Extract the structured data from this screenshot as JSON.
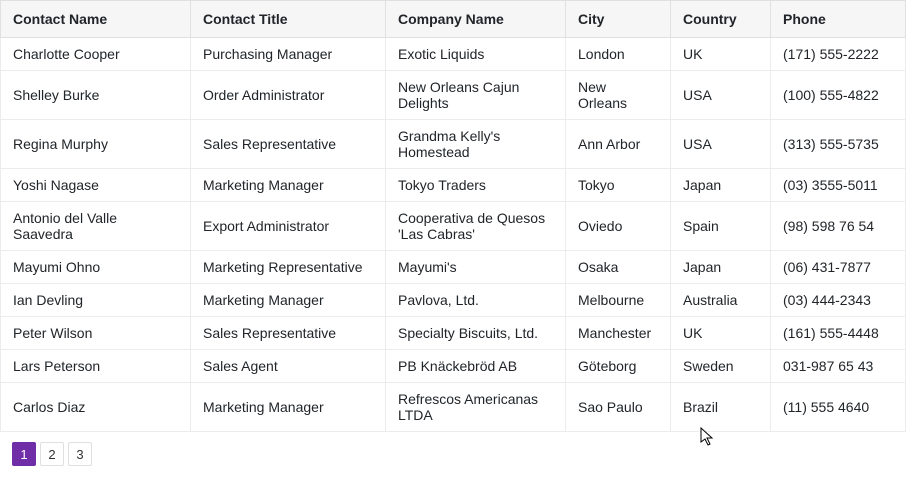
{
  "table": {
    "columns": [
      "Contact Name",
      "Contact Title",
      "Company Name",
      "City",
      "Country",
      "Phone"
    ],
    "rows": [
      {
        "name": "Charlotte Cooper",
        "title": "Purchasing Manager",
        "company": "Exotic Liquids",
        "city": "London",
        "country": "UK",
        "phone": "(171) 555-2222"
      },
      {
        "name": "Shelley Burke",
        "title": "Order Administrator",
        "company": "New Orleans Cajun Delights",
        "city": "New Orleans",
        "country": "USA",
        "phone": "(100) 555-4822"
      },
      {
        "name": "Regina Murphy",
        "title": "Sales Representative",
        "company": "Grandma Kelly's Homestead",
        "city": "Ann Arbor",
        "country": "USA",
        "phone": "(313) 555-5735"
      },
      {
        "name": "Yoshi Nagase",
        "title": "Marketing Manager",
        "company": "Tokyo Traders",
        "city": "Tokyo",
        "country": "Japan",
        "phone": "(03) 3555-5011"
      },
      {
        "name": "Antonio del Valle Saavedra",
        "title": "Export Administrator",
        "company": "Cooperativa de Quesos 'Las Cabras'",
        "city": "Oviedo",
        "country": "Spain",
        "phone": "(98) 598 76 54"
      },
      {
        "name": "Mayumi Ohno",
        "title": "Marketing Representative",
        "company": "Mayumi's",
        "city": "Osaka",
        "country": "Japan",
        "phone": "(06) 431-7877"
      },
      {
        "name": "Ian Devling",
        "title": "Marketing Manager",
        "company": "Pavlova, Ltd.",
        "city": "Melbourne",
        "country": "Australia",
        "phone": "(03) 444-2343"
      },
      {
        "name": "Peter Wilson",
        "title": "Sales Representative",
        "company": "Specialty Biscuits, Ltd.",
        "city": "Manchester",
        "country": "UK",
        "phone": "(161) 555-4448"
      },
      {
        "name": "Lars Peterson",
        "title": "Sales Agent",
        "company": "PB Knäckebröd AB",
        "city": "Göteborg",
        "country": "Sweden",
        "phone": "031-987 65 43"
      },
      {
        "name": "Carlos Diaz",
        "title": "Marketing Manager",
        "company": "Refrescos Americanas LTDA",
        "city": "Sao Paulo",
        "country": "Brazil",
        "phone": "(11) 555 4640"
      }
    ]
  },
  "pagination": {
    "pages": [
      "1",
      "2",
      "3"
    ],
    "active": "1"
  },
  "accent_color": "#6f2da8"
}
